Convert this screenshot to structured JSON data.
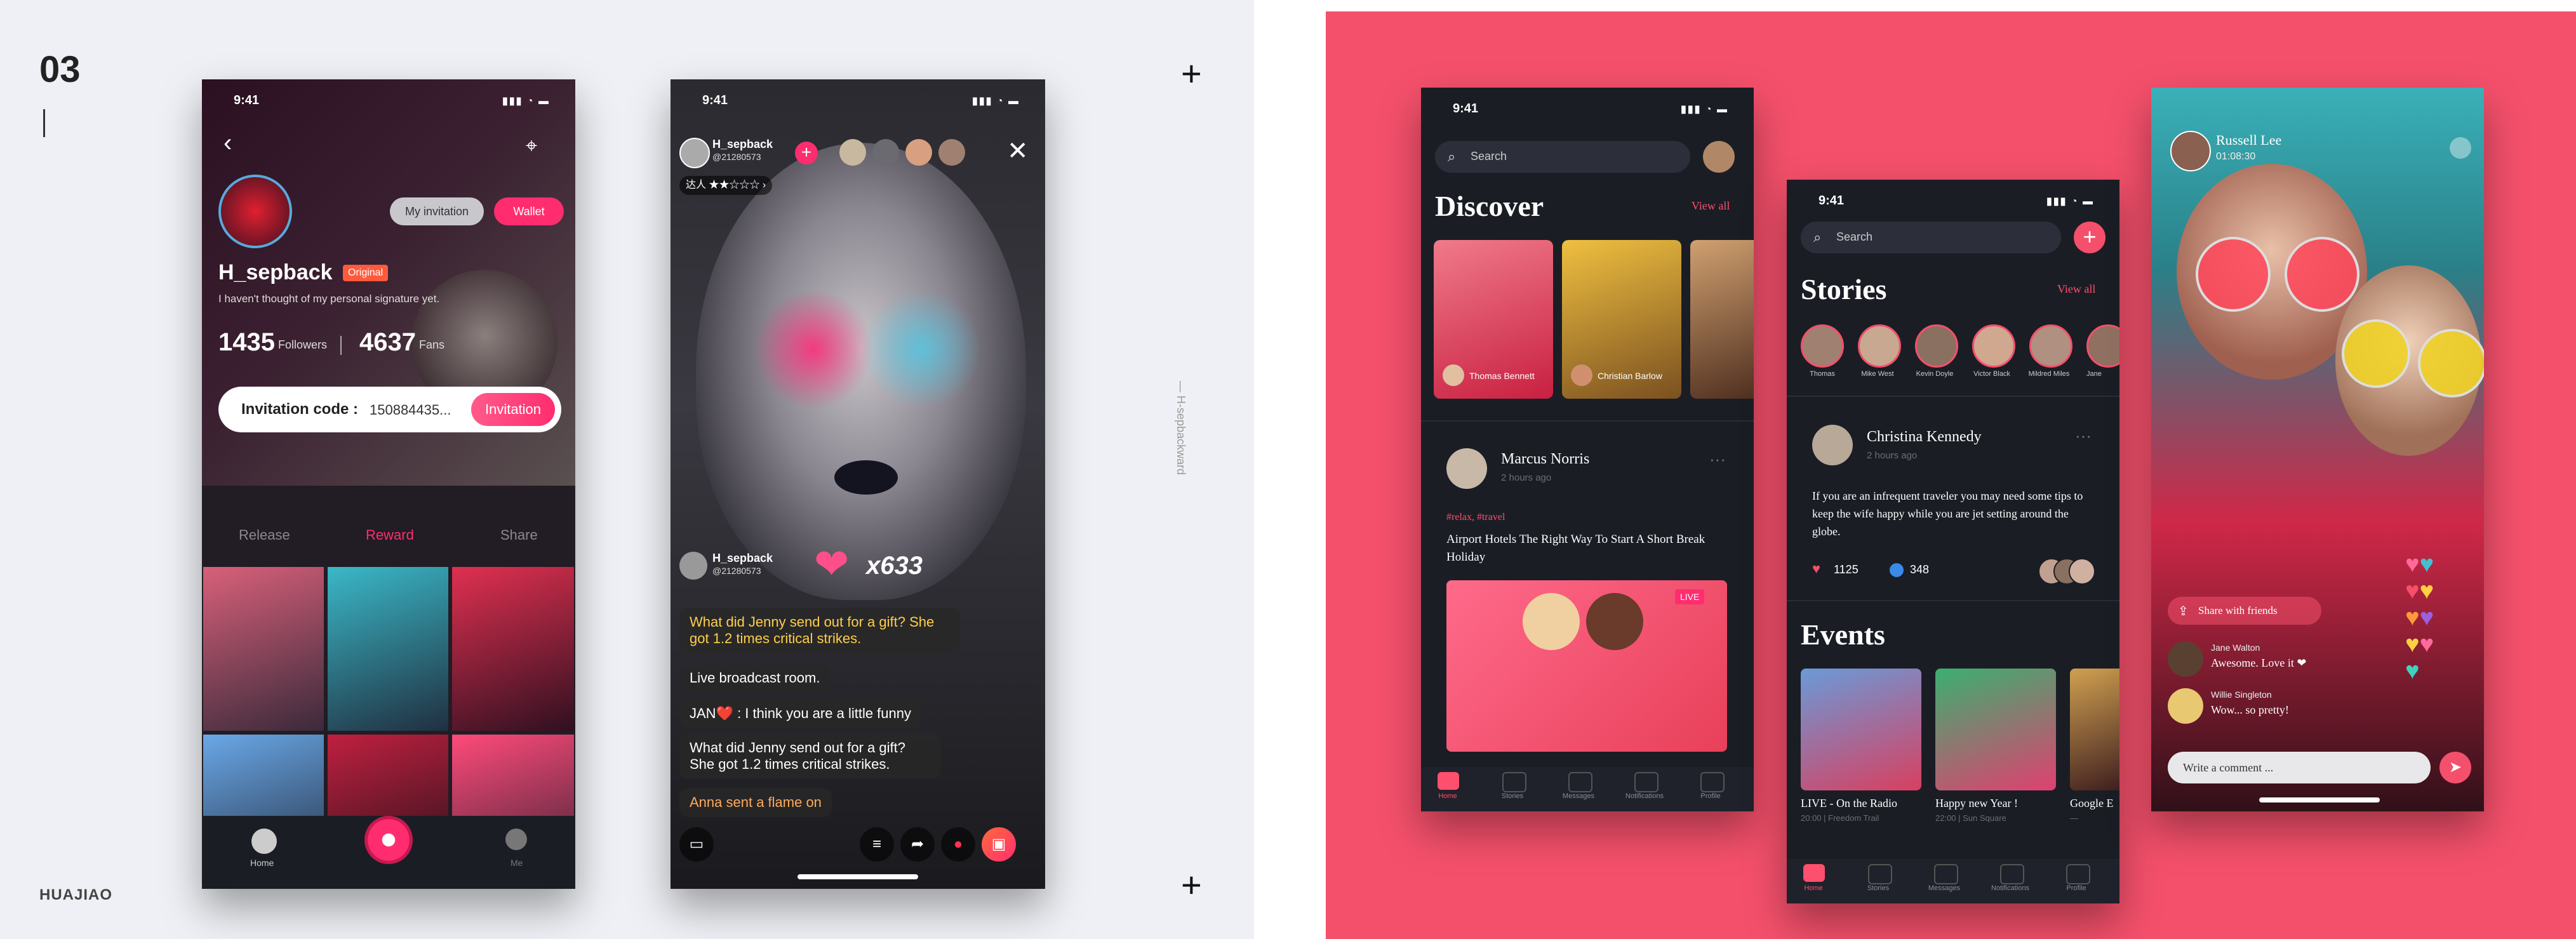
{
  "colors": {
    "accent": "#ff2d6f",
    "coral": "#f4506b",
    "dark": "#1b1d25",
    "orange": "#ff9a3c"
  },
  "left": {
    "number": "03",
    "brand": "HUAJIAO",
    "side_text": "— H-sepbackward",
    "phone1": {
      "time": "9:41",
      "username": "H_sepback",
      "badge": "Original",
      "signature": "I haven't thought of my personal signature yet.",
      "followers_count": "1435",
      "followers_label": "Followers",
      "fans_count": "4637",
      "fans_label": "Fans",
      "my_invitation": "My invitation",
      "wallet": "Wallet",
      "invitation_label": "Invitation code :",
      "invitation_code": "150884435...",
      "invitation_button": "Invitation",
      "tabs": [
        "Release",
        "Reward",
        "Share"
      ],
      "nav_home": "Home",
      "nav_me": "Me"
    },
    "phone2": {
      "time": "9:41",
      "host": "H_sepback",
      "host_id": "@21280573",
      "level": "达人",
      "gift_user": "H_sepback",
      "gift_user_id": "@21280573",
      "gift_count": "x633",
      "messages": [
        "What did Jenny send out for a gift? She got 1.2 times critical strikes.",
        "Live broadcast room.",
        "JAN❤️ : I think you are a little funny",
        "What did Jenny send out for a gift? She got 1.2 times critical strikes.",
        "Anna sent a flame on"
      ]
    }
  },
  "right": {
    "discover": {
      "time": "9:41",
      "search": "Search",
      "title": "Discover",
      "view_all": "View all",
      "card_names": [
        "Thomas Bennett",
        "Christian Barlow"
      ],
      "post_author": "Marcus Norris",
      "post_time": "2 hours ago",
      "post_tags": "#relax, #travel",
      "post_title": "Airport Hotels The Right Way To Start A Short Break Holiday",
      "live": "LIVE",
      "nav": [
        "Home",
        "Stories",
        "Messages",
        "Notifications",
        "Profile"
      ]
    },
    "stories": {
      "time": "9:41",
      "search": "Search",
      "title": "Stories",
      "view_all": "View all",
      "story_names": [
        "Thomas",
        "Mike West",
        "Kevin Doyle",
        "Victor Black",
        "Mildred Miles",
        "Jane"
      ],
      "post_author": "Christina Kennedy",
      "post_time": "2 hours ago",
      "post_body": "If you are an infrequent traveler you may need some tips to keep the wife happy while you are jet setting around the globe.",
      "likes": "1125",
      "comments": "348",
      "events_title": "Events",
      "events": [
        {
          "title": "LIVE - On the Radio",
          "sub": "20:00 | Freedom Trail"
        },
        {
          "title": "Happy new Year !",
          "sub": "22:00 | Sun Square"
        },
        {
          "title": "Google E",
          "sub": "—"
        }
      ],
      "nav": [
        "Home",
        "Stories",
        "Messages",
        "Notifications",
        "Profile"
      ]
    },
    "live": {
      "host": "Russell Lee",
      "duration": "01:08:30",
      "share": "Share with friends",
      "comments": [
        {
          "name": "Jane Walton",
          "text": "Awesome. Love it ❤"
        },
        {
          "name": "Willie Singleton",
          "text": "Wow... so pretty!"
        }
      ],
      "input_placeholder": "Write a comment ..."
    }
  }
}
